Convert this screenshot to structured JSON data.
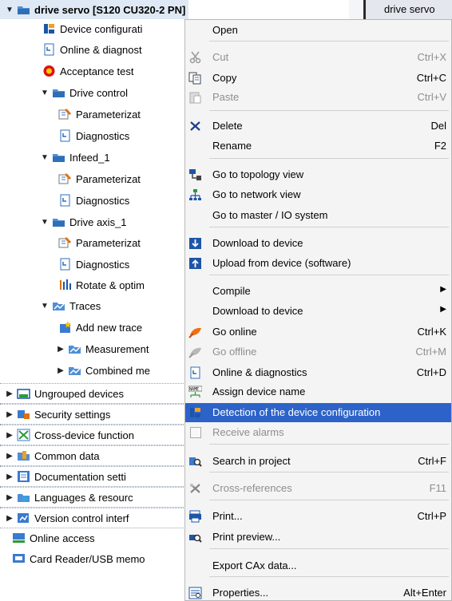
{
  "tree": {
    "rows": [
      {
        "label": "drive servo [S120 CU320-2 PN]",
        "arrow": "▼",
        "icon": "drive-device-icon"
      },
      {
        "label": "Device configurati",
        "arrow": "",
        "icon": "device-config-icon"
      },
      {
        "label": "Online & diagnost",
        "arrow": "",
        "icon": "online-diagnostics-icon"
      },
      {
        "label": "Acceptance test",
        "arrow": "",
        "icon": "acceptance-test-icon"
      },
      {
        "label": "Drive control",
        "arrow": "▼",
        "icon": "drive-folder-icon"
      },
      {
        "label": "Parameterizat",
        "arrow": "",
        "icon": "parameterization-icon"
      },
      {
        "label": "Diagnostics",
        "arrow": "",
        "icon": "diagnostics-icon"
      },
      {
        "label": "Infeed_1",
        "arrow": "▼",
        "icon": "infeed-folder-icon"
      },
      {
        "label": "Parameterizat",
        "arrow": "",
        "icon": "parameterization-icon"
      },
      {
        "label": "Diagnostics",
        "arrow": "",
        "icon": "diagnostics-icon"
      },
      {
        "label": "Drive axis_1",
        "arrow": "▼",
        "icon": "drive-folder-icon"
      },
      {
        "label": "Parameterizat",
        "arrow": "",
        "icon": "parameterization-icon"
      },
      {
        "label": "Diagnostics",
        "arrow": "",
        "icon": "diagnostics-icon"
      },
      {
        "label": "Rotate & optim",
        "arrow": "",
        "icon": "rotate-optimize-icon"
      },
      {
        "label": "Traces",
        "arrow": "▼",
        "icon": "traces-folder-icon"
      },
      {
        "label": "Add new trace",
        "arrow": "",
        "icon": "add-trace-icon"
      },
      {
        "label": "Measurement",
        "arrow": "▶",
        "icon": "measurement-folder-icon"
      },
      {
        "label": "Combined me",
        "arrow": "▶",
        "icon": "combined-folder-icon"
      },
      {
        "label": "Ungrouped devices",
        "arrow": "▶",
        "icon": "ungrouped-devices-icon"
      },
      {
        "label": "Security settings",
        "arrow": "▶",
        "icon": "security-settings-icon"
      },
      {
        "label": "Cross-device function",
        "arrow": "▶",
        "icon": "cross-device-icon"
      },
      {
        "label": "Common data",
        "arrow": "▶",
        "icon": "common-data-icon"
      },
      {
        "label": "Documentation setti",
        "arrow": "▶",
        "icon": "documentation-icon"
      },
      {
        "label": "Languages & resourc",
        "arrow": "▶",
        "icon": "languages-icon"
      },
      {
        "label": "Version control interf",
        "arrow": "▶",
        "icon": "version-control-icon"
      },
      {
        "label": "Online access",
        "arrow": "",
        "icon": "online-access-icon"
      },
      {
        "label": "Card Reader/USB memo",
        "arrow": "",
        "icon": "card-reader-icon"
      }
    ]
  },
  "editor_tab": {
    "label": "drive servo"
  },
  "context_menu": {
    "items": [
      {
        "label": "Open",
        "shortcut": "",
        "icon": "",
        "disabled": false,
        "submenu": false
      },
      {
        "label": "Cut",
        "shortcut": "Ctrl+X",
        "icon": "cut-icon",
        "disabled": true,
        "submenu": false
      },
      {
        "label": "Copy",
        "shortcut": "Ctrl+C",
        "icon": "copy-icon",
        "disabled": false,
        "submenu": false
      },
      {
        "label": "Paste",
        "shortcut": "Ctrl+V",
        "icon": "paste-icon",
        "disabled": true,
        "submenu": false
      },
      {
        "label": "Delete",
        "shortcut": "Del",
        "icon": "delete-icon",
        "disabled": false,
        "submenu": false
      },
      {
        "label": "Rename",
        "shortcut": "F2",
        "icon": "",
        "disabled": false,
        "submenu": false
      },
      {
        "label": "Go to topology view",
        "shortcut": "",
        "icon": "topology-view-icon",
        "disabled": false,
        "submenu": false
      },
      {
        "label": "Go to network view",
        "shortcut": "",
        "icon": "network-view-icon",
        "disabled": false,
        "submenu": false
      },
      {
        "label": "Go to master / IO system",
        "shortcut": "",
        "icon": "",
        "disabled": false,
        "submenu": false
      },
      {
        "label": "Download to device",
        "shortcut": "",
        "icon": "download-icon",
        "disabled": false,
        "submenu": false
      },
      {
        "label": "Upload from device (software)",
        "shortcut": "",
        "icon": "upload-icon",
        "disabled": false,
        "submenu": false
      },
      {
        "label": "Compile",
        "shortcut": "",
        "icon": "",
        "disabled": false,
        "submenu": true
      },
      {
        "label": "Download to device",
        "shortcut": "",
        "icon": "",
        "disabled": false,
        "submenu": true
      },
      {
        "label": "Go online",
        "shortcut": "Ctrl+K",
        "icon": "go-online-icon",
        "disabled": false,
        "submenu": false
      },
      {
        "label": "Go offline",
        "shortcut": "Ctrl+M",
        "icon": "go-offline-icon",
        "disabled": true,
        "submenu": false
      },
      {
        "label": "Online & diagnostics",
        "shortcut": "Ctrl+D",
        "icon": "online-diagnostics-icon",
        "disabled": false,
        "submenu": false
      },
      {
        "label": "Assign device name",
        "shortcut": "",
        "icon": "assign-name-icon",
        "disabled": false,
        "submenu": false
      },
      {
        "label": "Detection of the device configuration",
        "shortcut": "",
        "icon": "device-config-icon",
        "disabled": false,
        "submenu": false,
        "highlighted": true
      },
      {
        "label": "Receive alarms",
        "shortcut": "",
        "icon": "checkbox",
        "disabled": true,
        "submenu": false
      },
      {
        "label": "Search in project",
        "shortcut": "Ctrl+F",
        "icon": "search-project-icon",
        "disabled": false,
        "submenu": false
      },
      {
        "label": "Cross-references",
        "shortcut": "F11",
        "icon": "cross-references-icon",
        "disabled": true,
        "submenu": false
      },
      {
        "label": "Print...",
        "shortcut": "Ctrl+P",
        "icon": "print-icon",
        "disabled": false,
        "submenu": false
      },
      {
        "label": "Print preview...",
        "shortcut": "",
        "icon": "print-preview-icon",
        "disabled": false,
        "submenu": false
      },
      {
        "label": "Export CAx data...",
        "shortcut": "",
        "icon": "",
        "disabled": false,
        "submenu": false
      },
      {
        "label": "Properties...",
        "shortcut": "Alt+Enter",
        "icon": "properties-icon",
        "disabled": false,
        "submenu": false
      }
    ]
  },
  "colors": {
    "highlight": "#2d63c8",
    "selected_row": "#dfe9f5",
    "menu_bg": "#f4f4f4"
  }
}
